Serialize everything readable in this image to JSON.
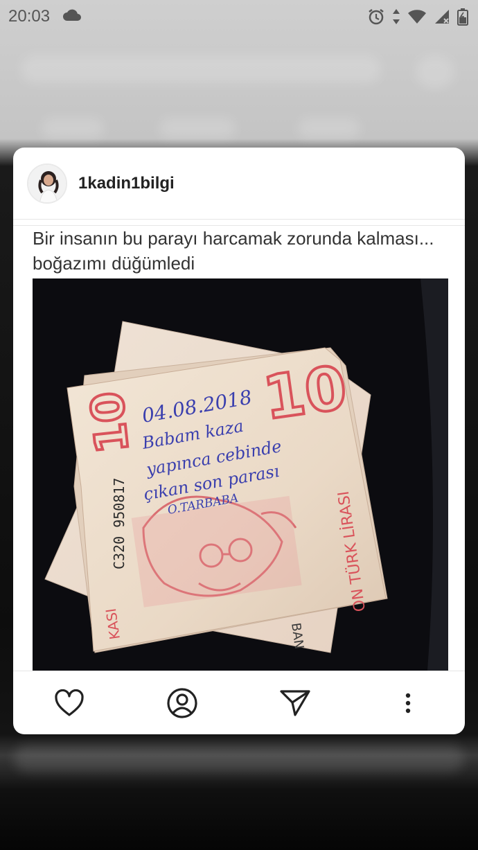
{
  "status_bar": {
    "time": "20:03",
    "icons": [
      "cloud-icon",
      "alarm-icon",
      "data-arrows-icon",
      "wifi-icon",
      "signal-icon",
      "battery-icon"
    ]
  },
  "post": {
    "username": "1kadin1bilgi",
    "caption": "Bir insanın bu parayı harcamak zorunda kalması... boğazımı düğümledi",
    "photo": {
      "banknote_numeral": "10",
      "serial": "C320 950817",
      "vertical_text": "ON TÜRK LİRASI",
      "bottom_left_text": "KASI",
      "bottom_text": "BAN",
      "handwriting_lines": [
        "04.08.2018",
        "Babam kaza",
        "yapınca cebinde",
        "çıkan son parası",
        "O.TARBABA"
      ]
    }
  },
  "actions": {
    "icons": [
      "heart-icon",
      "profile-icon",
      "send-icon",
      "more-vertical-icon"
    ]
  },
  "colors": {
    "card": "#ffffff",
    "text": "#222222",
    "note_red": "#d9535b",
    "ink_blue": "#3a3fae"
  }
}
